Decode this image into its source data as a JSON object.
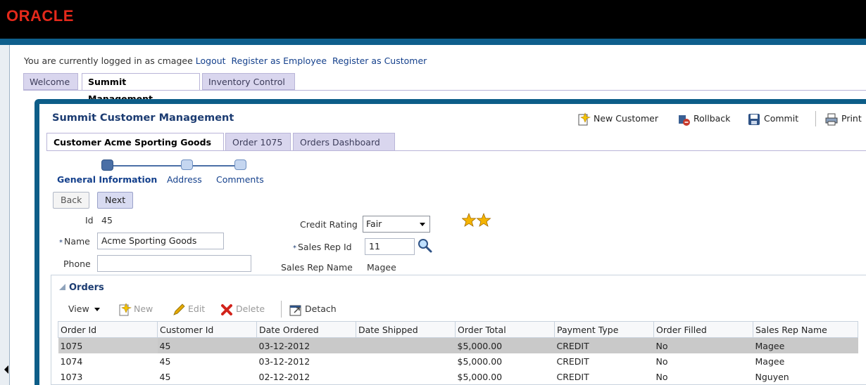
{
  "brand": {
    "logo": "ORACLE"
  },
  "login": {
    "prefix": "You are currently logged in as cmagee",
    "logout": "Logout",
    "register_employee": "Register as Employee",
    "register_customer": "Register as Customer"
  },
  "top_tabs": [
    {
      "label": "Welcome",
      "active": false
    },
    {
      "label": "Summit Management",
      "active": true
    },
    {
      "label": "Inventory Control",
      "active": false
    }
  ],
  "panel": {
    "title": "Summit Customer Management",
    "toolbar": {
      "new_customer": "New Customer",
      "rollback": "Rollback",
      "commit": "Commit",
      "print": "Print"
    }
  },
  "sub_tabs": [
    {
      "label": "Customer Acme Sporting Goods",
      "active": true
    },
    {
      "label": "Order 1075",
      "active": false
    },
    {
      "label": "Orders Dashboard",
      "active": false
    }
  ],
  "train": {
    "steps": [
      {
        "label": "General Information",
        "active": true
      },
      {
        "label": "Address",
        "active": false
      },
      {
        "label": "Comments",
        "active": false
      }
    ]
  },
  "nav": {
    "back": "Back",
    "next": "Next"
  },
  "form": {
    "id_label": "Id",
    "id_value": "45",
    "name_label": "Name",
    "name_value": "Acme Sporting Goods",
    "phone_label": "Phone",
    "phone_value": "",
    "credit_label": "Credit Rating",
    "credit_value": "Fair",
    "credit_stars": 2,
    "sales_rep_id_label": "Sales Rep Id",
    "sales_rep_id_value": "11",
    "sales_rep_name_label": "Sales Rep Name",
    "sales_rep_name_value": "Magee",
    "required_marker": "*"
  },
  "orders": {
    "header": "Orders",
    "toolbar": {
      "view": "View",
      "new": "New",
      "edit": "Edit",
      "delete": "Delete",
      "detach": "Detach"
    },
    "columns": [
      "Order Id",
      "Customer Id",
      "Date Ordered",
      "Date Shipped",
      "Order Total",
      "Payment Type",
      "Order Filled",
      "Sales Rep Name"
    ],
    "rows": [
      [
        "1075",
        "45",
        "03-12-2012",
        "",
        "$5,000.00",
        "CREDIT",
        "No",
        "Magee"
      ],
      [
        "1074",
        "45",
        "03-12-2012",
        "",
        "$5,000.00",
        "CREDIT",
        "No",
        "Magee"
      ],
      [
        "1073",
        "45",
        "02-12-2012",
        "",
        "$5,000.00",
        "CREDIT",
        "No",
        "Nguyen"
      ]
    ]
  },
  "colors": {
    "brand_red": "#e4291b",
    "frame_blue": "#0d5d88",
    "link_blue": "#14408c",
    "tab_lavender": "#d9d6ee",
    "selected_row": "#c9c9c9",
    "star_gold": "#f5b400"
  }
}
